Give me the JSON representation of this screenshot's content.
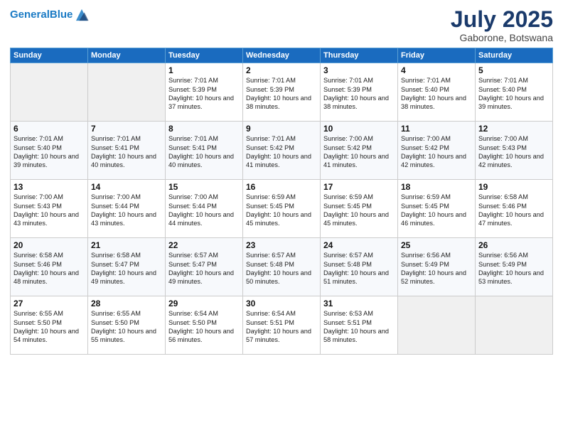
{
  "header": {
    "logo_line1": "General",
    "logo_line2": "Blue",
    "month": "July 2025",
    "location": "Gaborone, Botswana"
  },
  "days_of_week": [
    "Sunday",
    "Monday",
    "Tuesday",
    "Wednesday",
    "Thursday",
    "Friday",
    "Saturday"
  ],
  "weeks": [
    [
      {
        "day": "",
        "empty": true
      },
      {
        "day": "",
        "empty": true
      },
      {
        "day": "1",
        "sunrise": "7:01 AM",
        "sunset": "5:39 PM",
        "daylight": "10 hours and 37 minutes."
      },
      {
        "day": "2",
        "sunrise": "7:01 AM",
        "sunset": "5:39 PM",
        "daylight": "10 hours and 38 minutes."
      },
      {
        "day": "3",
        "sunrise": "7:01 AM",
        "sunset": "5:39 PM",
        "daylight": "10 hours and 38 minutes."
      },
      {
        "day": "4",
        "sunrise": "7:01 AM",
        "sunset": "5:40 PM",
        "daylight": "10 hours and 38 minutes."
      },
      {
        "day": "5",
        "sunrise": "7:01 AM",
        "sunset": "5:40 PM",
        "daylight": "10 hours and 39 minutes."
      }
    ],
    [
      {
        "day": "6",
        "sunrise": "7:01 AM",
        "sunset": "5:40 PM",
        "daylight": "10 hours and 39 minutes."
      },
      {
        "day": "7",
        "sunrise": "7:01 AM",
        "sunset": "5:41 PM",
        "daylight": "10 hours and 40 minutes."
      },
      {
        "day": "8",
        "sunrise": "7:01 AM",
        "sunset": "5:41 PM",
        "daylight": "10 hours and 40 minutes."
      },
      {
        "day": "9",
        "sunrise": "7:01 AM",
        "sunset": "5:42 PM",
        "daylight": "10 hours and 41 minutes."
      },
      {
        "day": "10",
        "sunrise": "7:00 AM",
        "sunset": "5:42 PM",
        "daylight": "10 hours and 41 minutes."
      },
      {
        "day": "11",
        "sunrise": "7:00 AM",
        "sunset": "5:42 PM",
        "daylight": "10 hours and 42 minutes."
      },
      {
        "day": "12",
        "sunrise": "7:00 AM",
        "sunset": "5:43 PM",
        "daylight": "10 hours and 42 minutes."
      }
    ],
    [
      {
        "day": "13",
        "sunrise": "7:00 AM",
        "sunset": "5:43 PM",
        "daylight": "10 hours and 43 minutes."
      },
      {
        "day": "14",
        "sunrise": "7:00 AM",
        "sunset": "5:44 PM",
        "daylight": "10 hours and 43 minutes."
      },
      {
        "day": "15",
        "sunrise": "7:00 AM",
        "sunset": "5:44 PM",
        "daylight": "10 hours and 44 minutes."
      },
      {
        "day": "16",
        "sunrise": "6:59 AM",
        "sunset": "5:45 PM",
        "daylight": "10 hours and 45 minutes."
      },
      {
        "day": "17",
        "sunrise": "6:59 AM",
        "sunset": "5:45 PM",
        "daylight": "10 hours and 45 minutes."
      },
      {
        "day": "18",
        "sunrise": "6:59 AM",
        "sunset": "5:45 PM",
        "daylight": "10 hours and 46 minutes."
      },
      {
        "day": "19",
        "sunrise": "6:58 AM",
        "sunset": "5:46 PM",
        "daylight": "10 hours and 47 minutes."
      }
    ],
    [
      {
        "day": "20",
        "sunrise": "6:58 AM",
        "sunset": "5:46 PM",
        "daylight": "10 hours and 48 minutes."
      },
      {
        "day": "21",
        "sunrise": "6:58 AM",
        "sunset": "5:47 PM",
        "daylight": "10 hours and 49 minutes."
      },
      {
        "day": "22",
        "sunrise": "6:57 AM",
        "sunset": "5:47 PM",
        "daylight": "10 hours and 49 minutes."
      },
      {
        "day": "23",
        "sunrise": "6:57 AM",
        "sunset": "5:48 PM",
        "daylight": "10 hours and 50 minutes."
      },
      {
        "day": "24",
        "sunrise": "6:57 AM",
        "sunset": "5:48 PM",
        "daylight": "10 hours and 51 minutes."
      },
      {
        "day": "25",
        "sunrise": "6:56 AM",
        "sunset": "5:49 PM",
        "daylight": "10 hours and 52 minutes."
      },
      {
        "day": "26",
        "sunrise": "6:56 AM",
        "sunset": "5:49 PM",
        "daylight": "10 hours and 53 minutes."
      }
    ],
    [
      {
        "day": "27",
        "sunrise": "6:55 AM",
        "sunset": "5:50 PM",
        "daylight": "10 hours and 54 minutes."
      },
      {
        "day": "28",
        "sunrise": "6:55 AM",
        "sunset": "5:50 PM",
        "daylight": "10 hours and 55 minutes."
      },
      {
        "day": "29",
        "sunrise": "6:54 AM",
        "sunset": "5:50 PM",
        "daylight": "10 hours and 56 minutes."
      },
      {
        "day": "30",
        "sunrise": "6:54 AM",
        "sunset": "5:51 PM",
        "daylight": "10 hours and 57 minutes."
      },
      {
        "day": "31",
        "sunrise": "6:53 AM",
        "sunset": "5:51 PM",
        "daylight": "10 hours and 58 minutes."
      },
      {
        "day": "",
        "empty": true
      },
      {
        "day": "",
        "empty": true
      }
    ]
  ],
  "labels": {
    "sunrise": "Sunrise:",
    "sunset": "Sunset:",
    "daylight": "Daylight:"
  }
}
